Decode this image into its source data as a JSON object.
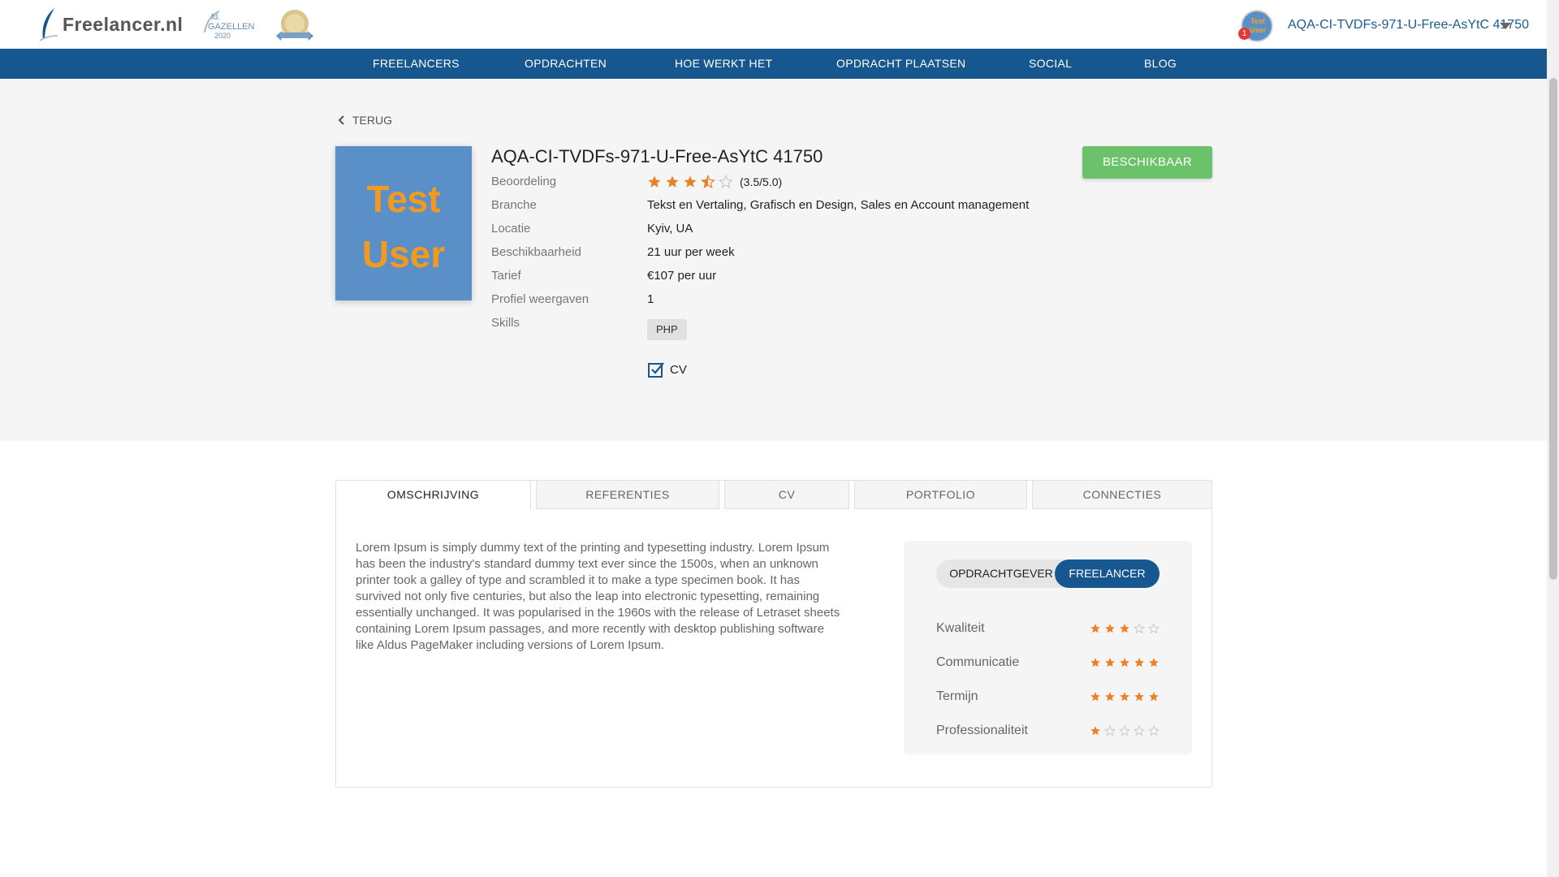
{
  "header": {
    "logo_text": "Freelancer.nl",
    "gazellen_badge": {
      "line1": "fd.",
      "line2": "GAZELLEN",
      "line3": "2020"
    },
    "user": {
      "avatar_text": "Test User",
      "notification_count": "1",
      "name": "AQA-CI-TVDFs-971-U-Free-AsYtC 41750"
    }
  },
  "nav": {
    "items": [
      "FREELANCERS",
      "OPDRACHTEN",
      "HOE WERKT HET",
      "OPDRACHT PLAATSEN",
      "SOCIAL",
      "BLOG"
    ]
  },
  "profile": {
    "back_label": "TERUG",
    "image_text": {
      "line1": "Test",
      "line2": "User"
    },
    "name": "AQA-CI-TVDFs-971-U-Free-AsYtC 41750",
    "status_button": "BESCHIKBAAR",
    "labels": {
      "rating": "Beoordeling",
      "branch": "Branche",
      "location": "Locatie",
      "availability": "Beschikbaarheid",
      "rate": "Tarief",
      "views": "Profiel weergaven",
      "skills": "Skills"
    },
    "rating_value": 3.5,
    "rating_text": "(3.5/5.0)",
    "branch": "Tekst en Vertaling, Grafisch en Design, Sales en Account management",
    "location": "Kyiv, UA",
    "availability": "21 uur per week",
    "rate": "€107 per uur",
    "views": "1",
    "skills": [
      "PHP"
    ],
    "cv_label": "CV"
  },
  "tabs": [
    {
      "label": "OMSCHRIJVING",
      "active": true
    },
    {
      "label": "REFERENTIES",
      "active": false
    },
    {
      "label": "CV",
      "active": false
    },
    {
      "label": "PORTFOLIO",
      "active": false
    },
    {
      "label": "CONNECTIES",
      "active": false
    }
  ],
  "description": "Lorem Ipsum is simply dummy text of the printing and typesetting industry. Lorem Ipsum has been the industry's standard dummy text ever since the 1500s, when an unknown printer took a galley of type and scrambled it to make a type specimen book. It has survived not only five centuries, but also the leap into electronic typesetting, remaining essentially unchanged. It was popularised in the 1960s with the release of Letraset sheets containing Lorem Ipsum passages, and more recently with desktop publishing software like Aldus PageMaker including versions of Lorem Ipsum.",
  "reviews": {
    "toggle": {
      "left": "OPDRACHTGEVER",
      "right": "FREELANCER",
      "selected": "FREELANCER"
    },
    "criteria": [
      {
        "label": "Kwaliteit",
        "stars": 3
      },
      {
        "label": "Communicatie",
        "stars": 5
      },
      {
        "label": "Termijn",
        "stars": 5
      },
      {
        "label": "Professionaliteit",
        "stars": 1
      }
    ]
  },
  "colors": {
    "primary": "#17578f",
    "star": "#e8832a",
    "star_empty": "#c8c8c8",
    "available": "#6bc26a",
    "band": "#f5f5f5"
  }
}
